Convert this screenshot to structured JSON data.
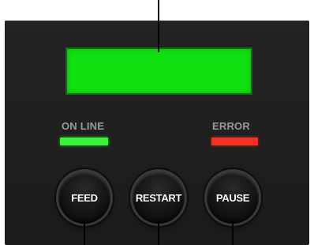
{
  "indicators": {
    "online_label": "ON LINE",
    "error_label": "ERROR",
    "online_color": "#3af23a",
    "error_color": "#ef3426"
  },
  "display": {
    "color": "#10e010"
  },
  "buttons": {
    "feed": "FEED",
    "restart": "RESTART",
    "pause": "PAUSE"
  },
  "icons": {
    "online_led": "green-led-icon",
    "error_led": "red-led-icon"
  }
}
